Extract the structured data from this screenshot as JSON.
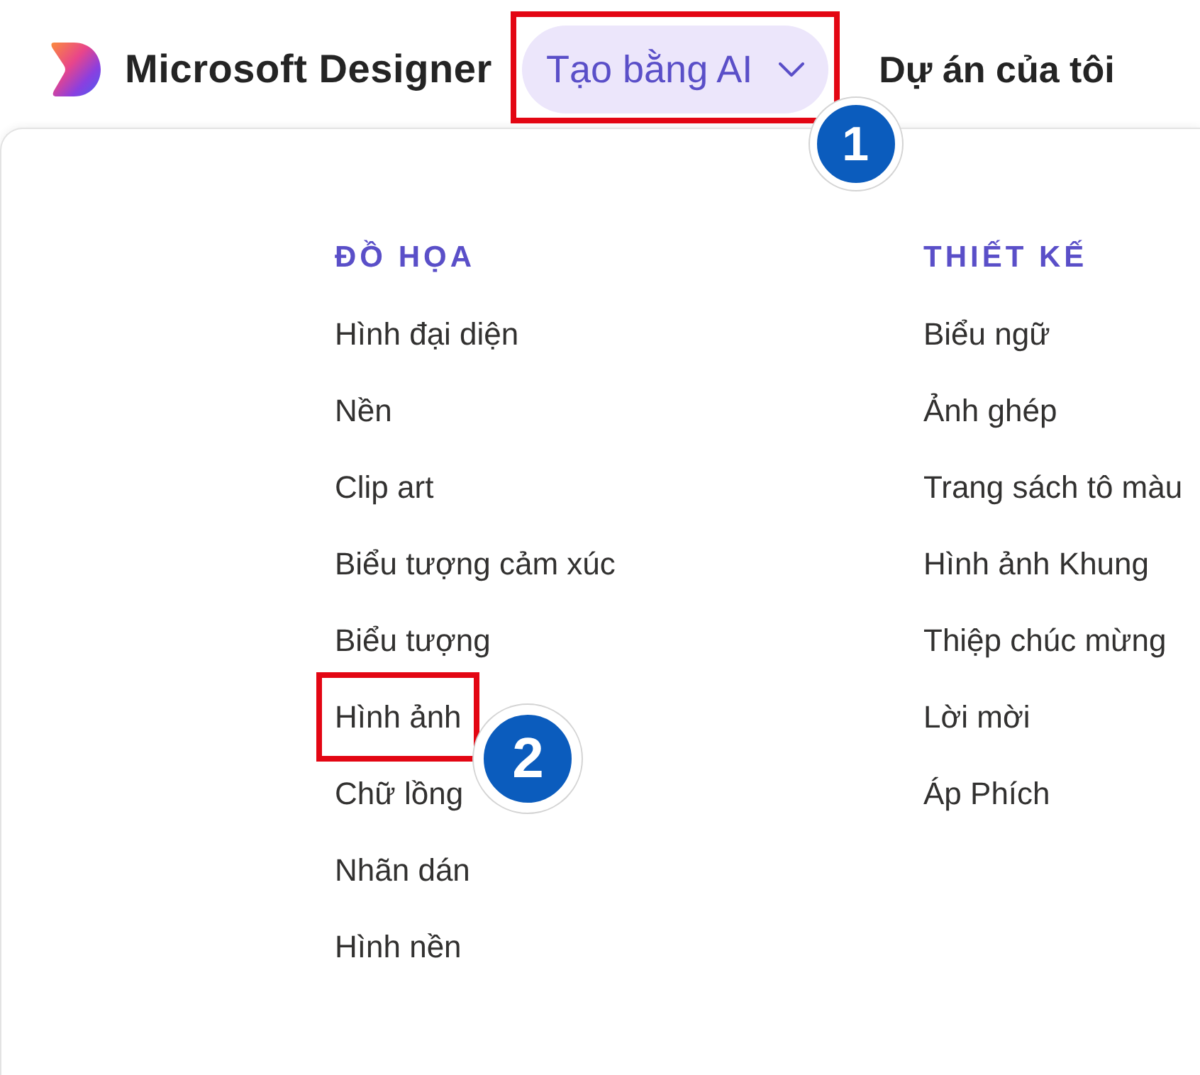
{
  "header": {
    "logo_text": "Microsoft Designer",
    "nav": [
      {
        "label": "Tạo bằng AI",
        "kind": "dropdown",
        "selected": true,
        "highlighted": true,
        "step": "1"
      },
      {
        "label": "Dự án của tôi",
        "kind": "link",
        "selected": false,
        "highlighted": false
      }
    ]
  },
  "menu": {
    "columns": [
      {
        "heading": "ĐỒ HỌA",
        "items": [
          {
            "label": "Hình đại diện",
            "highlighted": false
          },
          {
            "label": "Nền",
            "highlighted": false
          },
          {
            "label": "Clip art",
            "highlighted": false
          },
          {
            "label": "Biểu tượng cảm xúc",
            "highlighted": false
          },
          {
            "label": "Biểu tượng",
            "highlighted": false
          },
          {
            "label": "Hình ảnh",
            "highlighted": true,
            "step": "2"
          },
          {
            "label": "Chữ lồng",
            "highlighted": false
          },
          {
            "label": "Nhãn dán",
            "highlighted": false
          },
          {
            "label": "Hình nền",
            "highlighted": false
          }
        ]
      },
      {
        "heading": "THIẾT KẾ",
        "items": [
          {
            "label": "Biểu ngữ",
            "highlighted": false
          },
          {
            "label": "Ảnh ghép",
            "highlighted": false
          },
          {
            "label": "Trang sách tô màu",
            "highlighted": false
          },
          {
            "label": "Hình ảnh Khung",
            "highlighted": false
          },
          {
            "label": "Thiệp chúc mừng",
            "highlighted": false
          },
          {
            "label": "Lời mời",
            "highlighted": false
          },
          {
            "label": "Áp Phích",
            "highlighted": false
          }
        ]
      }
    ]
  }
}
